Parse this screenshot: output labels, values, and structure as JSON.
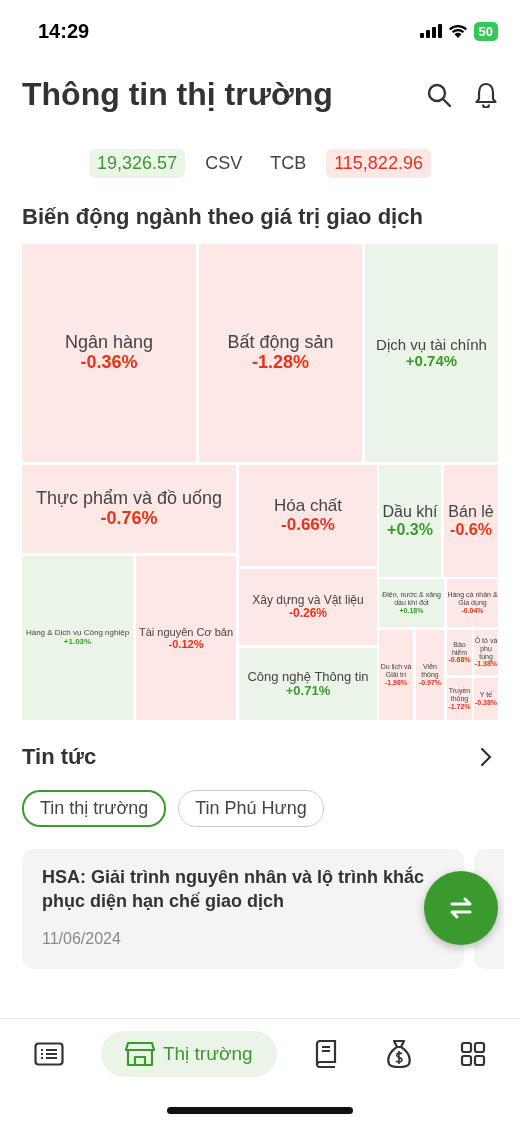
{
  "status_bar": {
    "time": "14:29",
    "battery": "50"
  },
  "header": {
    "title": "Thông tin thị trường"
  },
  "ticker": [
    {
      "kind": "value",
      "text": "19,326.57",
      "positive": true
    },
    {
      "kind": "symbol",
      "text": "CSV"
    },
    {
      "kind": "symbol",
      "text": "TCB"
    },
    {
      "kind": "value",
      "text": "115,822.96",
      "positive": false
    }
  ],
  "sector_map": {
    "title": "Biến động ngành theo giá trị giao dịch",
    "cells": [
      {
        "name": "Ngân hàng",
        "change": "-0.36%",
        "positive": false
      },
      {
        "name": "Bất động sản",
        "change": "-1.28%",
        "positive": false
      },
      {
        "name": "Dịch vụ tài chính",
        "change": "+0.74%",
        "positive": true
      },
      {
        "name": "Thực phẩm và đồ uống",
        "change": "-0.76%",
        "positive": false
      },
      {
        "name": "Hóa chất",
        "change": "-0.66%",
        "positive": false
      },
      {
        "name": "Dầu khí",
        "change": "+0.3%",
        "positive": true
      },
      {
        "name": "Bán lẻ",
        "change": "-0.6%",
        "positive": false
      },
      {
        "name": "Hàng & Dịch vụ Công nghiệp",
        "change": "+1.03%",
        "positive": true
      },
      {
        "name": "Tài nguyên Cơ bản",
        "change": "-0.12%",
        "positive": false
      },
      {
        "name": "Xây dựng và Vật liệu",
        "change": "-0.26%",
        "positive": false
      },
      {
        "name": "Công nghệ Thông tin",
        "change": "+0.71%",
        "positive": true
      },
      {
        "name": "Điện, nước & xăng dầu khí đốt",
        "change": "+0.18%",
        "positive": true
      },
      {
        "name": "Hàng cá nhân & Gia dụng",
        "change": "-0.04%",
        "positive": false
      },
      {
        "name": "Du lịch và Giải trí",
        "change": "-1.98%",
        "positive": false
      },
      {
        "name": "Viễn thông",
        "change": "-0.97%",
        "positive": false
      },
      {
        "name": "Bảo hiểm",
        "change": "-0.68%",
        "positive": false
      },
      {
        "name": "Ô tô và phụ tùng",
        "change": "-1.38%",
        "positive": false
      },
      {
        "name": "Truyền thông",
        "change": "-1.72%",
        "positive": false
      },
      {
        "name": "Y tế",
        "change": "-0.38%",
        "positive": false
      }
    ]
  },
  "news": {
    "title": "Tin tức",
    "tabs": [
      {
        "label": "Tin thị trường",
        "selected": true
      },
      {
        "label": "Tin Phú Hưng",
        "selected": false
      }
    ],
    "articles": [
      {
        "title": "HSA: Giải trình nguyên nhân và lộ trình khắc phục diện hạn chế giao dịch",
        "date": "11/06/2024"
      }
    ]
  },
  "bottom_nav": [
    {
      "kind": "list",
      "selected": false
    },
    {
      "kind": "store",
      "label": "Thị trường",
      "selected": true
    },
    {
      "kind": "book",
      "selected": false
    },
    {
      "kind": "money",
      "selected": false
    },
    {
      "kind": "grid",
      "selected": false
    }
  ]
}
